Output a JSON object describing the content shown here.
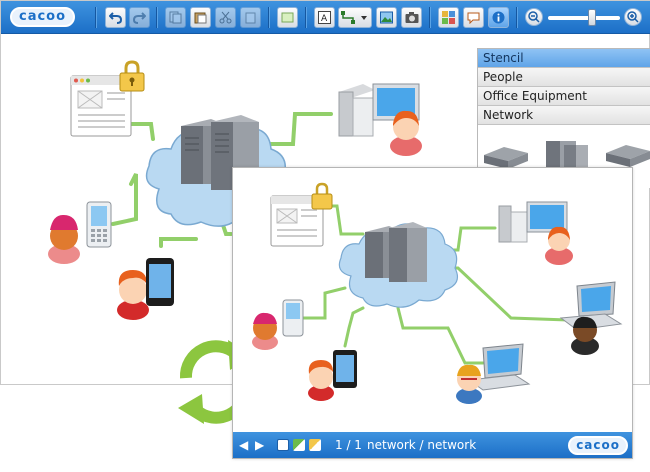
{
  "toolbar": {
    "logo": "cacoo",
    "buttons": [
      "undo-icon",
      "redo-icon",
      "copy-icon",
      "paste-icon",
      "cut-icon",
      "paste-format-icon",
      "shape-icon",
      "text-icon",
      "connector-icon",
      "image-icon",
      "camera-icon",
      "stencil-icon",
      "comment-icon",
      "info-icon",
      "zoom-out-icon",
      "zoom-in-icon"
    ]
  },
  "stencil": {
    "items": [
      "Stencil",
      "People",
      "Office Equipment",
      "Network"
    ]
  },
  "viewer": {
    "page": "1 / 1",
    "title": "network / network",
    "logo": "cacoo"
  },
  "colors": {
    "toolbar_blue": "#1c6fc7",
    "connector_green": "#92cf6a",
    "cloud_blue": "#b9d9f2",
    "sync_arrow_green": "#8cc63f"
  }
}
